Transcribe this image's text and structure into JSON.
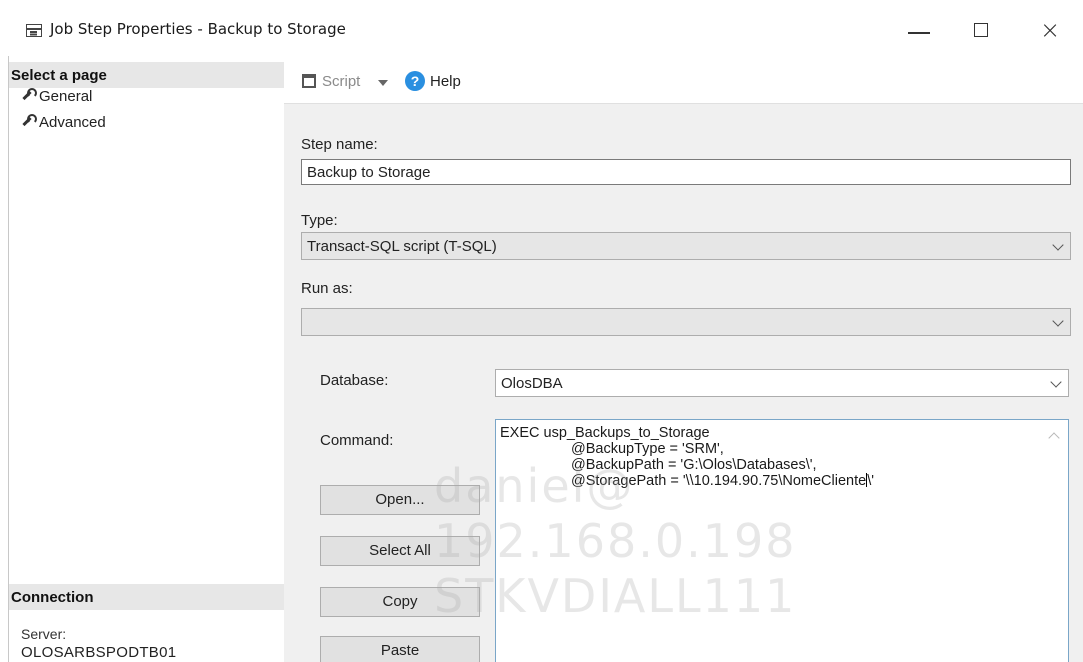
{
  "window": {
    "title": "Job Step Properties - Backup to Storage",
    "controls": {
      "close_glyph": "×"
    }
  },
  "sidebar": {
    "select_page_header": "Select a page",
    "items": [
      {
        "label": "General",
        "icon": "wrench-icon"
      },
      {
        "label": "Advanced",
        "icon": "wrench-icon"
      }
    ],
    "connection_header": "Connection",
    "server_label": "Server:",
    "server_value": "OLOSARBSPODTB01"
  },
  "toolbar": {
    "script_label": "Script",
    "help_label": "Help",
    "help_glyph": "?"
  },
  "form": {
    "step_name_label": "Step name:",
    "step_name_value": "Backup to Storage",
    "type_label": "Type:",
    "type_value": "Transact-SQL script (T-SQL)",
    "run_as_label": "Run as:",
    "run_as_value": "",
    "database_label": "Database:",
    "database_value": "OlosDBA",
    "command_label": "Command:",
    "command_lines": [
      "EXEC usp_Backups_to_Storage",
      "@BackupType = 'SRM',",
      "@BackupPath = 'G:\\Olos\\Databases\\',",
      "@StoragePath = '\\\\10.194.90.75\\NomeCliente\\'"
    ],
    "buttons": {
      "open": "Open...",
      "select_all": "Select All",
      "copy": "Copy",
      "paste": "Paste"
    }
  },
  "watermark": {
    "line1": "daniel@",
    "line2": "192.168.0.198",
    "line3": "STKVDIALL111"
  },
  "colors": {
    "form_background": "#f0f0f0",
    "pane_header": "#e7e7e7",
    "help_icon": "#2a8fe0",
    "command_border": "#7aa6c8"
  }
}
